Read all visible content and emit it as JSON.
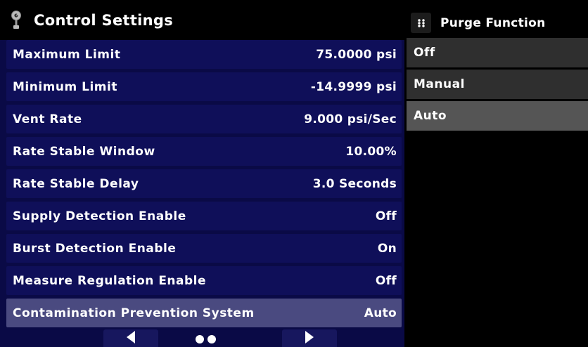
{
  "header": {
    "title": "Control Settings",
    "icon": "thermometer-icon"
  },
  "settings": [
    {
      "label": "Maximum Limit",
      "value": "75.0000 psi"
    },
    {
      "label": "Minimum Limit",
      "value": "-14.9999 psi"
    },
    {
      "label": "Vent Rate",
      "value": "9.000 psi/Sec"
    },
    {
      "label": "Rate Stable Window",
      "value": "10.00%"
    },
    {
      "label": "Rate Stable Delay",
      "value": "3.0 Seconds"
    },
    {
      "label": "Supply Detection Enable",
      "value": "Off"
    },
    {
      "label": "Burst Detection Enable",
      "value": "On"
    },
    {
      "label": "Measure Regulation Enable",
      "value": "Off"
    },
    {
      "label": "Contamination Prevention System",
      "value": "Auto",
      "selected": true
    }
  ],
  "pager": {
    "page_count": 2,
    "prev_icon": "left-arrow-icon",
    "next_icon": "right-arrow-icon"
  },
  "panel": {
    "title": "Purge Function",
    "icon": "grid-icon",
    "options": [
      "Off",
      "Manual",
      "Auto"
    ],
    "selected": "Auto"
  },
  "colors": {
    "background": "#0a0a46",
    "row": "#0f0f59",
    "row_selected": "#4a4a80",
    "option": "#2f2f2f",
    "option_selected": "#555555"
  }
}
